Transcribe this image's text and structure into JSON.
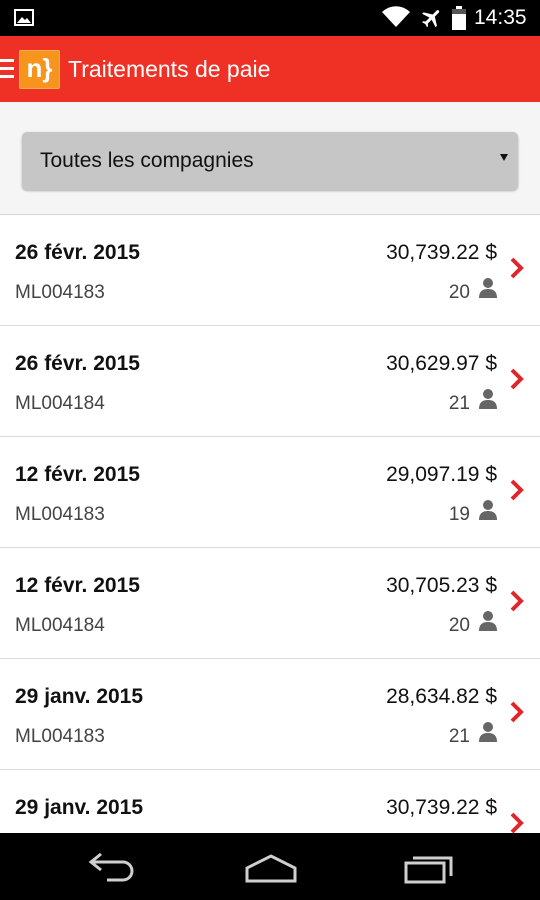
{
  "status_bar": {
    "time": "14:35",
    "icons": [
      "gallery-icon",
      "wifi-icon",
      "airplane-mode-icon",
      "battery-icon"
    ]
  },
  "app_bar": {
    "logo_text": "n}",
    "title": "Traitements de paie",
    "icons": [
      "menu-icon"
    ]
  },
  "filter": {
    "selected": "Toutes les compagnies"
  },
  "payrolls": [
    {
      "date": "26 févr. 2015",
      "code": "ML004183",
      "amount": "30,739.22 $",
      "employees": "20"
    },
    {
      "date": "26 févr. 2015",
      "code": "ML004184",
      "amount": "30,629.97 $",
      "employees": "21"
    },
    {
      "date": "12 févr. 2015",
      "code": "ML004183",
      "amount": "29,097.19 $",
      "employees": "19"
    },
    {
      "date": "12 févr. 2015",
      "code": "ML004184",
      "amount": "30,705.23 $",
      "employees": "20"
    },
    {
      "date": "29 janv. 2015",
      "code": "ML004183",
      "amount": "28,634.82 $",
      "employees": "21"
    },
    {
      "date": "29 janv. 2015",
      "code": "",
      "amount": "30,739.22 $",
      "employees": ""
    }
  ],
  "nav_bar": {
    "icons": [
      "back-icon",
      "home-icon",
      "recent-apps-icon"
    ]
  },
  "colors": {
    "accent": "#ef3125",
    "logo": "#f7941d",
    "chevron": "#e0262c",
    "person_icon": "#666666"
  }
}
